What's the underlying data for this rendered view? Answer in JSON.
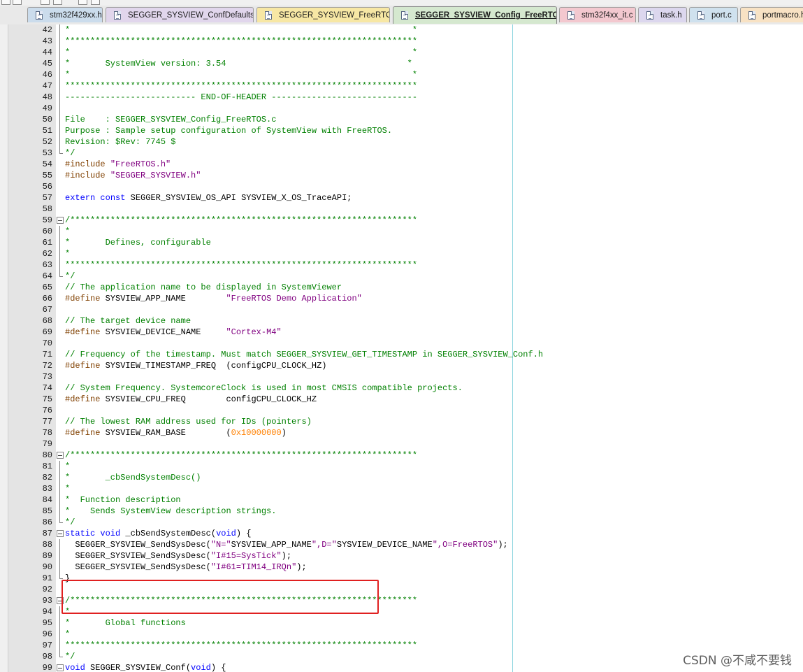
{
  "editor": {
    "tabs": [
      {
        "label": "stm32f429xx.h",
        "color": "#cbdcec",
        "active": false
      },
      {
        "label": "SEGGER_SYSVIEW_ConfDefaults.h",
        "color": "#e1d6ec",
        "active": false
      },
      {
        "label": "SEGGER_SYSVIEW_FreeRTOS.c",
        "color": "#f7e7a4",
        "active": false
      },
      {
        "label": "SEGGER_SYSVIEW_Config_FreeRTOS.c",
        "color": "#d5e8cf",
        "active": true
      },
      {
        "label": "stm32f4xx_it.c",
        "color": "#f3c8cf",
        "active": false
      },
      {
        "label": "task.h",
        "color": "#dcd7ee",
        "active": false
      },
      {
        "label": "port.c",
        "color": "#cfe1ee",
        "active": false
      },
      {
        "label": "portmacro.h",
        "color": "#f8e2c4",
        "active": false
      }
    ],
    "lines": [
      {
        "n": "42",
        "fold": "vline",
        "tokens": [
          [
            "c",
            "*                                                                    *"
          ]
        ]
      },
      {
        "n": "43",
        "fold": "vline",
        "tokens": [
          [
            "c",
            "**********************************************************************"
          ]
        ]
      },
      {
        "n": "44",
        "fold": "vline",
        "tokens": [
          [
            "c",
            "*                                                                    *"
          ]
        ]
      },
      {
        "n": "45",
        "fold": "vline",
        "tokens": [
          [
            "c",
            "*       SystemView version: 3.54                                    *"
          ]
        ]
      },
      {
        "n": "46",
        "fold": "vline",
        "tokens": [
          [
            "c",
            "*                                                                    *"
          ]
        ]
      },
      {
        "n": "47",
        "fold": "vline",
        "tokens": [
          [
            "c",
            "**********************************************************************"
          ]
        ]
      },
      {
        "n": "48",
        "fold": "vline",
        "tokens": [
          [
            "c",
            "-------------------------- END-OF-HEADER -----------------------------"
          ]
        ]
      },
      {
        "n": "49",
        "fold": "vline",
        "tokens": []
      },
      {
        "n": "50",
        "fold": "vline",
        "tokens": [
          [
            "c",
            "File    : SEGGER_SYSVIEW_Config_FreeRTOS.c"
          ]
        ]
      },
      {
        "n": "51",
        "fold": "vline",
        "tokens": [
          [
            "c",
            "Purpose : Sample setup configuration of SystemView with FreeRTOS."
          ]
        ]
      },
      {
        "n": "52",
        "fold": "vline",
        "tokens": [
          [
            "c",
            "Revision: $Rev: 7745 $"
          ]
        ]
      },
      {
        "n": "53",
        "fold": "end",
        "tokens": [
          [
            "c",
            "*/"
          ]
        ]
      },
      {
        "n": "54",
        "fold": "",
        "tokens": [
          [
            "p",
            "#include "
          ],
          [
            "s",
            "\"FreeRTOS.h\""
          ]
        ]
      },
      {
        "n": "55",
        "fold": "",
        "tokens": [
          [
            "p",
            "#include "
          ],
          [
            "s",
            "\"SEGGER_SYSVIEW.h\""
          ]
        ]
      },
      {
        "n": "56",
        "fold": "",
        "tokens": []
      },
      {
        "n": "57",
        "fold": "",
        "tokens": [
          [
            "k",
            "extern"
          ],
          [
            "t",
            " "
          ],
          [
            "k",
            "const"
          ],
          [
            "t",
            " SEGGER_SYSVIEW_OS_API SYSVIEW_X_OS_TraceAPI;"
          ]
        ]
      },
      {
        "n": "58",
        "fold": "",
        "tokens": []
      },
      {
        "n": "59",
        "fold": "box",
        "tokens": [
          [
            "c",
            "/*********************************************************************"
          ]
        ]
      },
      {
        "n": "60",
        "fold": "vline",
        "tokens": [
          [
            "c",
            "*"
          ]
        ]
      },
      {
        "n": "61",
        "fold": "vline",
        "tokens": [
          [
            "c",
            "*       Defines, configurable"
          ]
        ]
      },
      {
        "n": "62",
        "fold": "vline",
        "tokens": [
          [
            "c",
            "*"
          ]
        ]
      },
      {
        "n": "63",
        "fold": "vline",
        "tokens": [
          [
            "c",
            "**********************************************************************"
          ]
        ]
      },
      {
        "n": "64",
        "fold": "end",
        "tokens": [
          [
            "c",
            "*/"
          ]
        ]
      },
      {
        "n": "65",
        "fold": "",
        "tokens": [
          [
            "c",
            "// The application name to be displayed in SystemViewer"
          ]
        ]
      },
      {
        "n": "66",
        "fold": "",
        "tokens": [
          [
            "p",
            "#define"
          ],
          [
            "t",
            " SYSVIEW_APP_NAME        "
          ],
          [
            "s",
            "\"FreeRTOS Demo Application\""
          ]
        ]
      },
      {
        "n": "67",
        "fold": "",
        "tokens": []
      },
      {
        "n": "68",
        "fold": "",
        "tokens": [
          [
            "c",
            "// The target device name"
          ]
        ]
      },
      {
        "n": "69",
        "fold": "",
        "tokens": [
          [
            "p",
            "#define"
          ],
          [
            "t",
            " SYSVIEW_DEVICE_NAME     "
          ],
          [
            "s",
            "\"Cortex-M4\""
          ]
        ]
      },
      {
        "n": "70",
        "fold": "",
        "tokens": []
      },
      {
        "n": "71",
        "fold": "",
        "tokens": [
          [
            "c",
            "// Frequency of the timestamp. Must match SEGGER_SYSVIEW_GET_TIMESTAMP in SEGGER_SYSVIEW_Conf.h"
          ]
        ]
      },
      {
        "n": "72",
        "fold": "",
        "tokens": [
          [
            "p",
            "#define"
          ],
          [
            "t",
            " SYSVIEW_TIMESTAMP_FREQ  (configCPU_CLOCK_HZ)"
          ]
        ]
      },
      {
        "n": "73",
        "fold": "",
        "tokens": []
      },
      {
        "n": "74",
        "fold": "",
        "tokens": [
          [
            "c",
            "// System Frequency. SystemcoreClock is used in most CMSIS compatible projects."
          ]
        ]
      },
      {
        "n": "75",
        "fold": "",
        "tokens": [
          [
            "p",
            "#define"
          ],
          [
            "t",
            " SYSVIEW_CPU_FREQ        configCPU_CLOCK_HZ"
          ]
        ]
      },
      {
        "n": "76",
        "fold": "",
        "tokens": []
      },
      {
        "n": "77",
        "fold": "",
        "tokens": [
          [
            "c",
            "// The lowest RAM address used for IDs (pointers)"
          ]
        ]
      },
      {
        "n": "78",
        "fold": "",
        "tokens": [
          [
            "p",
            "#define"
          ],
          [
            "t",
            " SYSVIEW_RAM_BASE        ("
          ],
          [
            "n",
            "0x10000000"
          ],
          [
            "t",
            ")"
          ]
        ]
      },
      {
        "n": "79",
        "fold": "",
        "tokens": []
      },
      {
        "n": "80",
        "fold": "box",
        "tokens": [
          [
            "c",
            "/*********************************************************************"
          ]
        ]
      },
      {
        "n": "81",
        "fold": "vline",
        "tokens": [
          [
            "c",
            "*"
          ]
        ]
      },
      {
        "n": "82",
        "fold": "vline",
        "tokens": [
          [
            "c",
            "*       _cbSendSystemDesc()"
          ]
        ]
      },
      {
        "n": "83",
        "fold": "vline",
        "tokens": [
          [
            "c",
            "*"
          ]
        ]
      },
      {
        "n": "84",
        "fold": "vline",
        "tokens": [
          [
            "c",
            "*  Function description"
          ]
        ]
      },
      {
        "n": "85",
        "fold": "vline",
        "tokens": [
          [
            "c",
            "*    Sends SystemView description strings."
          ]
        ]
      },
      {
        "n": "86",
        "fold": "end",
        "tokens": [
          [
            "c",
            "*/"
          ]
        ]
      },
      {
        "n": "87",
        "fold": "box",
        "tokens": [
          [
            "k",
            "static"
          ],
          [
            "t",
            " "
          ],
          [
            "k",
            "void"
          ],
          [
            "t",
            " _cbSendSystemDesc("
          ],
          [
            "k",
            "void"
          ],
          [
            "t",
            ") {"
          ]
        ]
      },
      {
        "n": "88",
        "fold": "vline",
        "tokens": [
          [
            "t",
            "  SEGGER_SYSVIEW_SendSysDesc("
          ],
          [
            "s",
            "\"N=\""
          ],
          [
            "t",
            "SYSVIEW_APP_NAME"
          ],
          [
            "s",
            "\",D=\""
          ],
          [
            "t",
            "SYSVIEW_DEVICE_NAME"
          ],
          [
            "s",
            "\",O=FreeRTOS\""
          ],
          [
            "t",
            ");"
          ]
        ]
      },
      {
        "n": "89",
        "fold": "vline",
        "tokens": [
          [
            "t",
            "  SEGGER_SYSVIEW_SendSysDesc("
          ],
          [
            "s",
            "\"I#15=SysTick\""
          ],
          [
            "t",
            ");"
          ]
        ]
      },
      {
        "n": "90",
        "fold": "vline",
        "tokens": [
          [
            "t",
            "  SEGGER_SYSVIEW_SendSysDesc("
          ],
          [
            "s",
            "\"I#61=TIM14_IRQn\""
          ],
          [
            "t",
            ");"
          ]
        ]
      },
      {
        "n": "91",
        "fold": "end",
        "tokens": [
          [
            "t",
            "}"
          ]
        ]
      },
      {
        "n": "92",
        "fold": "",
        "tokens": []
      },
      {
        "n": "93",
        "fold": "box",
        "tokens": [
          [
            "c",
            "/*********************************************************************"
          ]
        ]
      },
      {
        "n": "94",
        "fold": "vline",
        "tokens": [
          [
            "c",
            "*"
          ]
        ]
      },
      {
        "n": "95",
        "fold": "vline",
        "tokens": [
          [
            "c",
            "*       Global functions"
          ]
        ]
      },
      {
        "n": "96",
        "fold": "vline",
        "tokens": [
          [
            "c",
            "*"
          ]
        ]
      },
      {
        "n": "97",
        "fold": "vline",
        "tokens": [
          [
            "c",
            "**********************************************************************"
          ]
        ]
      },
      {
        "n": "98",
        "fold": "end",
        "tokens": [
          [
            "c",
            "*/"
          ]
        ]
      },
      {
        "n": "99",
        "fold": "box",
        "tokens": [
          [
            "k",
            "void"
          ],
          [
            "t",
            " SEGGER_SYSVIEW_Conf("
          ],
          [
            "k",
            "void"
          ],
          [
            "t",
            ") {"
          ]
        ]
      }
    ]
  },
  "colors": {
    "comment": "#008000",
    "keyword": "#0000ff",
    "preprocessor": "#804000",
    "string": "#800080",
    "number": "#ff8000",
    "highlight_box": "#e02020",
    "edge_line": "#8fd6e0"
  },
  "watermark": "CSDN @不咸不要钱"
}
